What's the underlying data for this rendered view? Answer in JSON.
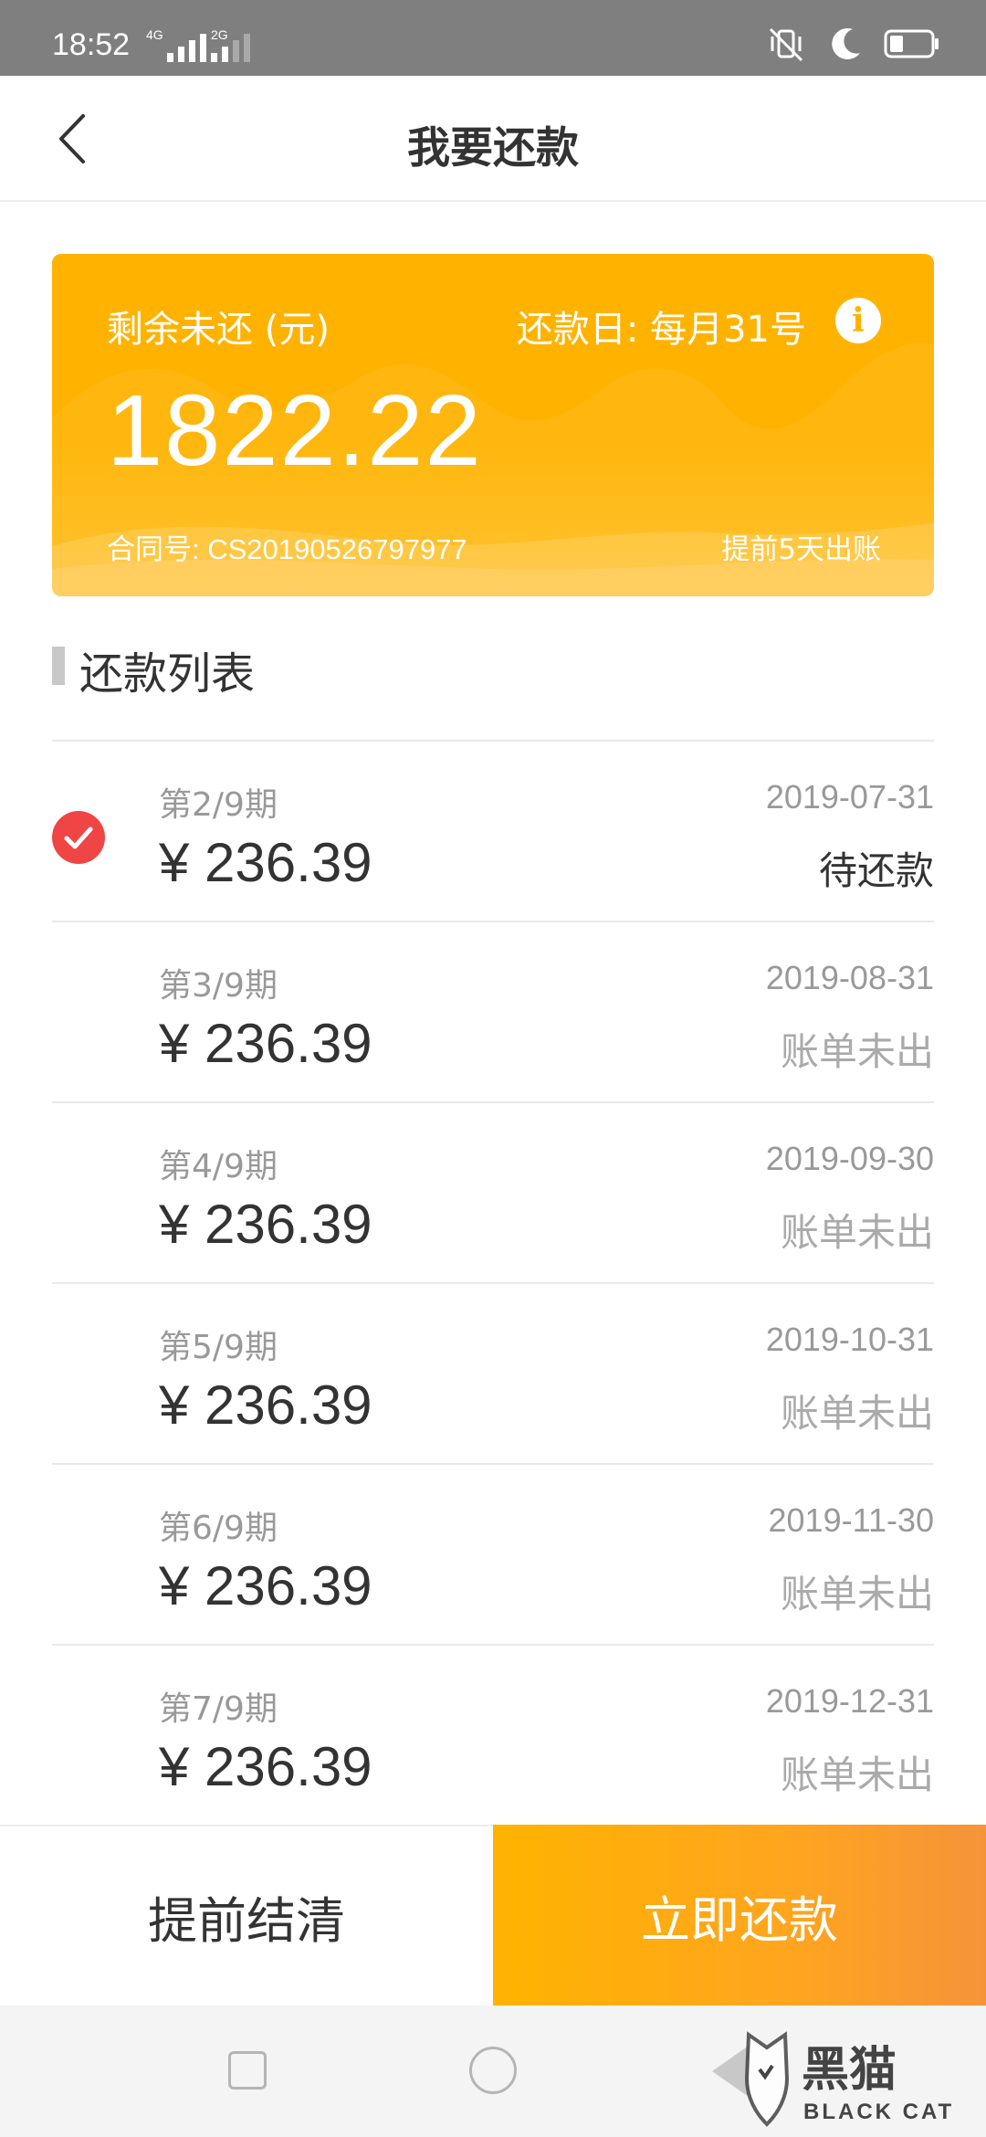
{
  "status_bar": {
    "time": "18:52",
    "network_1": "4G",
    "network_2": "2G",
    "icons": [
      "mute-vibrate-icon",
      "moon-icon",
      "battery-icon"
    ]
  },
  "header": {
    "title": "我要还款",
    "back_icon": "chevron-left-icon"
  },
  "summary": {
    "remaining_label": "剩余未还 (元)",
    "due_day_label": "还款日: 每月31号",
    "info_icon": "i",
    "amount": "1822.22",
    "contract_label": "合同号: CS20190526797977",
    "billing_note": "提前5天出账"
  },
  "section": {
    "title": "还款列表"
  },
  "installments": [
    {
      "period": "第2/9期",
      "amount": "¥ 236.39",
      "date": "2019-07-31",
      "status": "待还款",
      "selected": true
    },
    {
      "period": "第3/9期",
      "amount": "¥ 236.39",
      "date": "2019-08-31",
      "status": "账单未出",
      "selected": false
    },
    {
      "period": "第4/9期",
      "amount": "¥ 236.39",
      "date": "2019-09-30",
      "status": "账单未出",
      "selected": false
    },
    {
      "period": "第5/9期",
      "amount": "¥ 236.39",
      "date": "2019-10-31",
      "status": "账单未出",
      "selected": false
    },
    {
      "period": "第6/9期",
      "amount": "¥ 236.39",
      "date": "2019-11-30",
      "status": "账单未出",
      "selected": false
    },
    {
      "period": "第7/9期",
      "amount": "¥ 236.39",
      "date": "2019-12-31",
      "status": "账单未出",
      "selected": false
    }
  ],
  "actions": {
    "settle_label": "提前结清",
    "pay_label": "立即还款"
  },
  "watermark": {
    "logo_text": "黑猫",
    "logo_sub": "BLACK CAT"
  },
  "colors": {
    "accent": "#ffb300",
    "check": "#f04545",
    "muted": "#999999"
  }
}
